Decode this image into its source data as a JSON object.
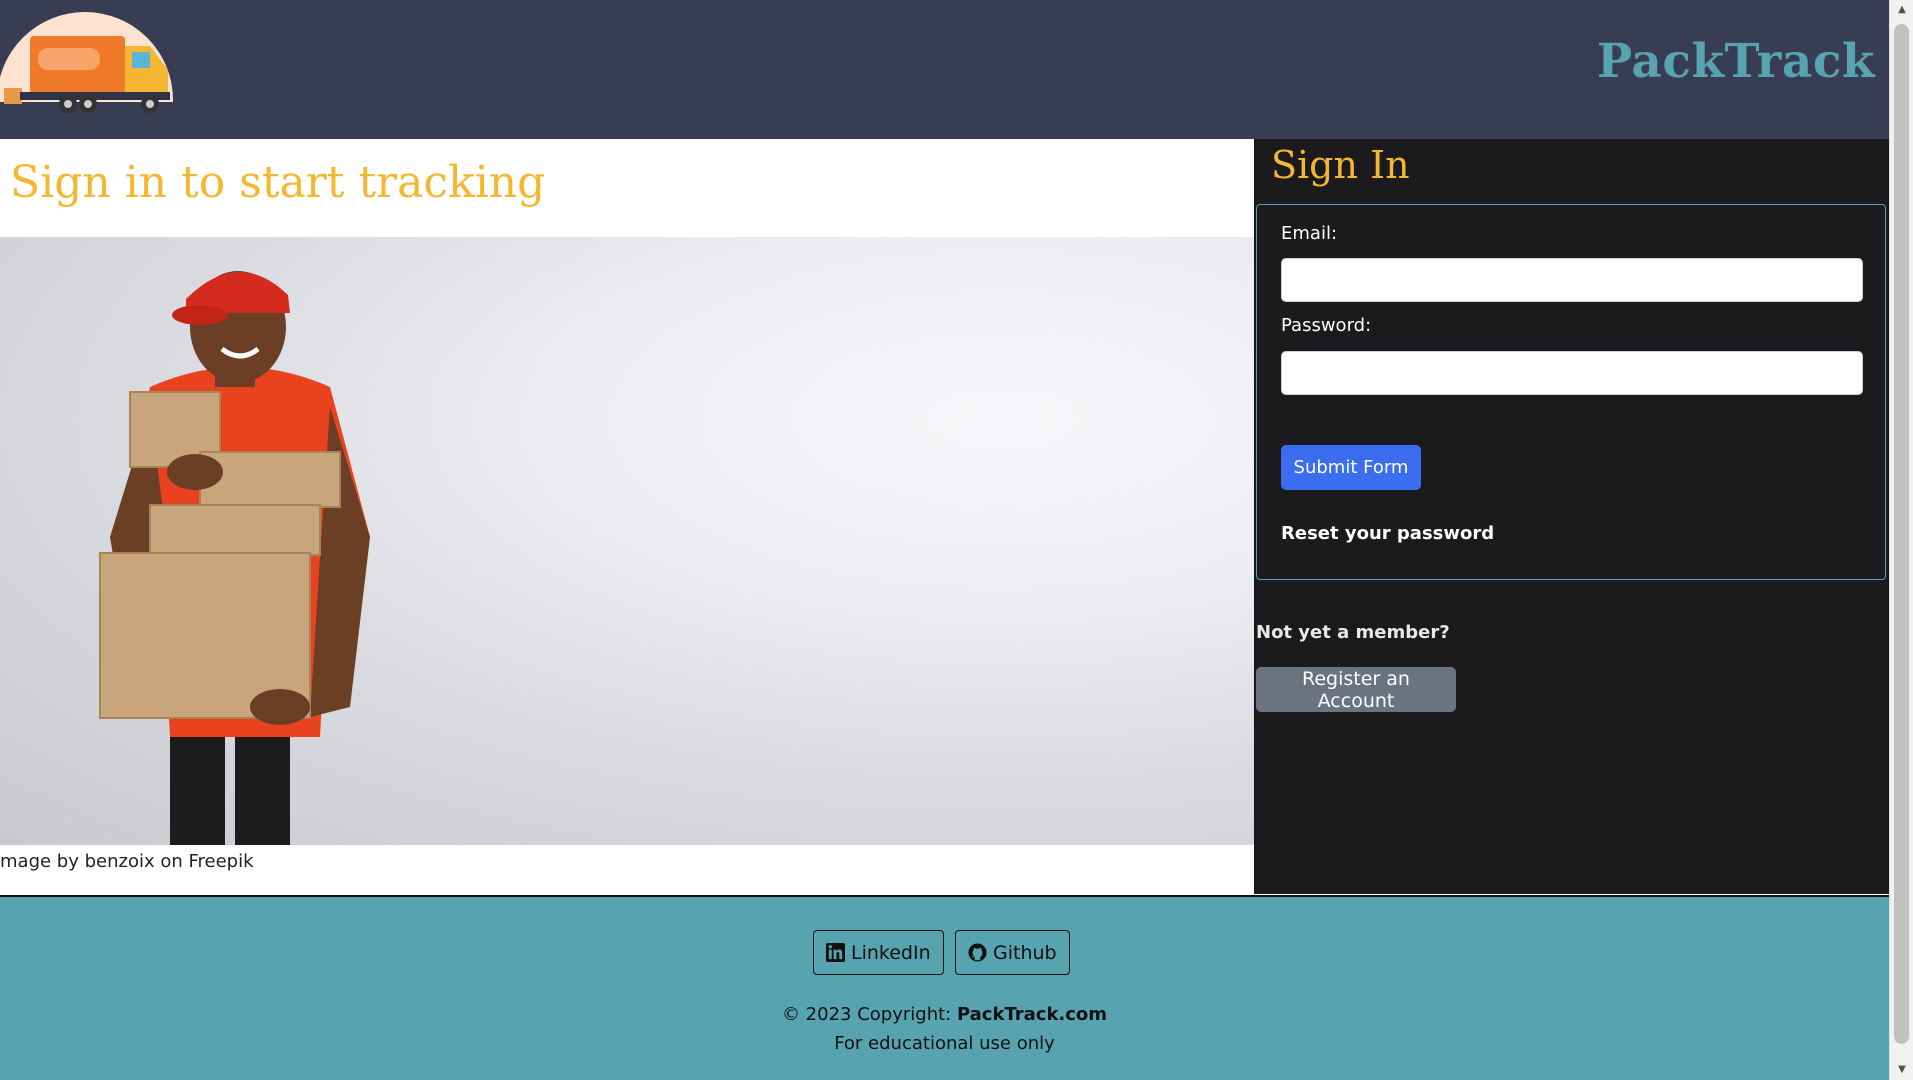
{
  "header": {
    "brand": "PackTrack",
    "logo_icon": "delivery-truck-logo"
  },
  "hero": {
    "title": "Sign in to start tracking",
    "image_alt": "delivery man holding cardboard boxes",
    "caption": "mage by benzoix on Freepik"
  },
  "signin": {
    "title": "Sign In",
    "email_label": "Email:",
    "email_value": "",
    "password_label": "Password:",
    "password_value": "",
    "submit_label": "Submit Form",
    "reset_label": "Reset your password",
    "not_member": "Not yet a member?",
    "register_label": "Register an Account"
  },
  "footer": {
    "linkedin_label": "LinkedIn",
    "github_label": "Github",
    "copyright_prefix": "© 2023 Copyright: ",
    "copyright_site": "PackTrack.com",
    "note": "For educational use only"
  },
  "colors": {
    "header_bg": "#383d53",
    "brand": "#58a3b0",
    "accent_yellow": "#f5b731",
    "panel_bg": "#1b1b1e",
    "primary_button": "#3a6df0",
    "secondary_button": "#6b7280",
    "footer_bg": "#58a3b0"
  }
}
